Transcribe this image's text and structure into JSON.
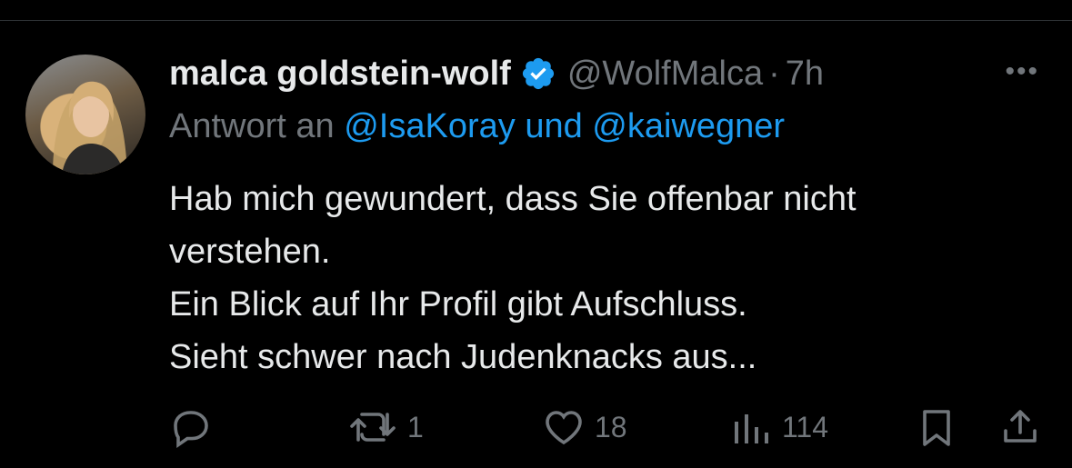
{
  "tweet": {
    "author_name": "malca goldstein-wolf",
    "author_handle": "@WolfMalca",
    "separator": "·",
    "time": "7h",
    "more_label": "•••",
    "reply_prefix": "Antwort an",
    "reply_user1": "@IsaKoray",
    "reply_and": "und",
    "reply_user2": "@kaiwegner",
    "text_lines": [
      "Hab mich gewundert, dass Sie offenbar nicht",
      "verstehen.",
      "Ein Blick auf Ihr Profil gibt Aufschluss.",
      "Sieht schwer nach Judenknacks aus..."
    ]
  },
  "actions": {
    "reply_icon": "reply-icon",
    "retweet_icon": "retweet-icon",
    "retweet_count": "1",
    "like_icon": "heart-icon",
    "like_count": "18",
    "views_icon": "views-icon",
    "views_count": "114",
    "bookmark_icon": "bookmark-icon",
    "share_icon": "share-icon"
  },
  "colors": {
    "background": "#000000",
    "text": "#e7e9ea",
    "secondary": "#71767b",
    "link": "#1d9bf0",
    "divider": "#2f3336"
  }
}
